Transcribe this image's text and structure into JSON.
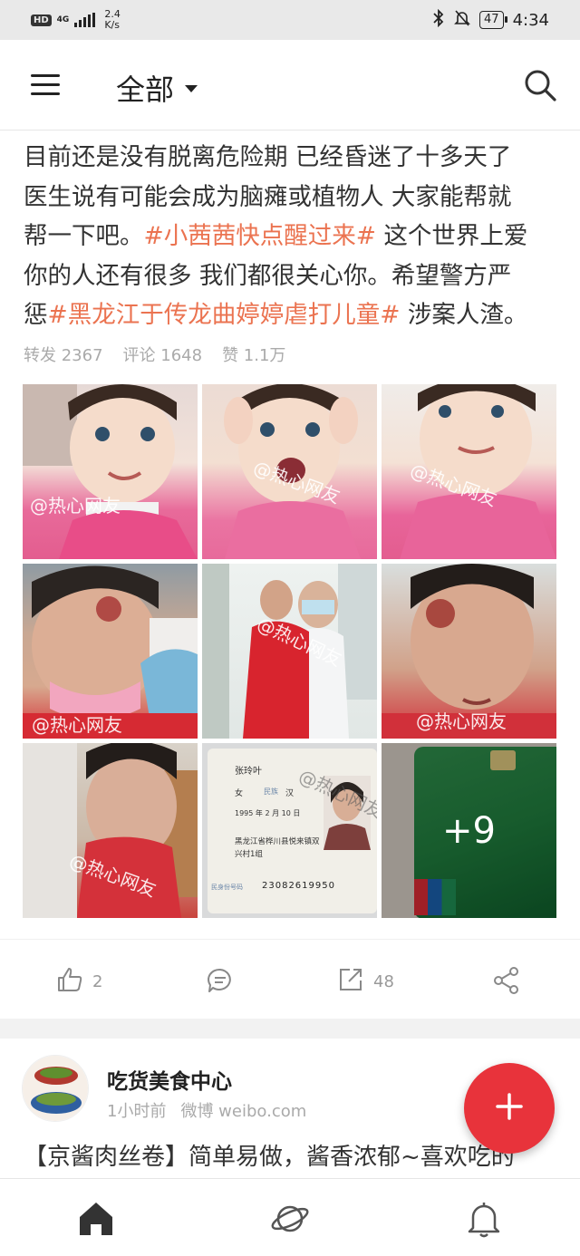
{
  "status_bar": {
    "hd": "HD",
    "network": "4G",
    "speed_value": "2.4",
    "speed_unit": "K/s",
    "battery": "47",
    "time": "4:34"
  },
  "app_bar": {
    "title": "全部"
  },
  "post": {
    "text_line1": "目前还是没有脱离危险期 已经昏迷了十多天了",
    "text_line2": "医生说有可能会成为脑瘫或植物人 大家能帮就",
    "text_line3_a": "帮一下吧。",
    "hashtag1": "#小茜茜快点醒过来#",
    "text_line3_b": " 这个世界上爱",
    "text_line4": "你的人还有很多 我们都很关心你。希望警方严",
    "text_line5_a": "惩",
    "hashtag2": "#黑龙江于传龙曲婷婷虐打儿童#",
    "text_line5_b": " 涉案人渣。",
    "stats": {
      "reposts": "转发 2367",
      "comments": "评论 1648",
      "likes": "赞 1.1万"
    },
    "watermark": "@热心网友",
    "id_card": {
      "name": "张玲叶",
      "gender": "女",
      "ethnicity_label": "民族",
      "ethnicity": "汉",
      "birth": "1995 年 2 月 10 日",
      "address_line1": "黑龙江省桦川县悦来镇双",
      "address_line2": "兴村1组",
      "id_label": "民身份号码",
      "id_number": "23082619950"
    },
    "more_images": "+9",
    "actions": {
      "like_count": "2",
      "repost_count": "48"
    }
  },
  "post2": {
    "author": "吃货美食中心",
    "time": "1小时前",
    "source": "微博 weibo.com",
    "text": "【京酱肉丝卷】简单易做，酱香浓郁~喜欢吃的"
  },
  "colors": {
    "accent": "#e8333b",
    "hashtag": "#eb7350"
  }
}
